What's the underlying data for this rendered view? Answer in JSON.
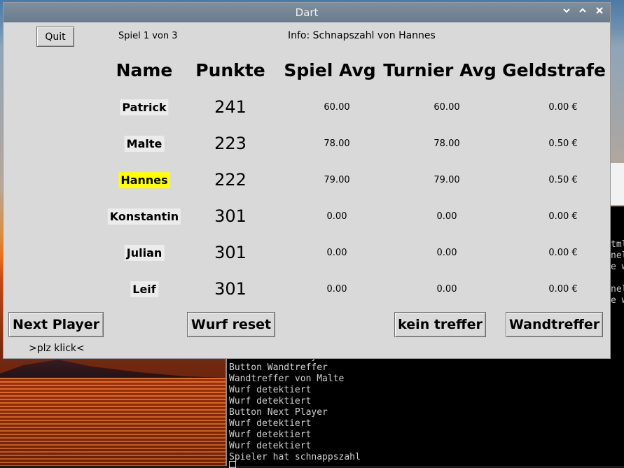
{
  "window": {
    "title": "Dart"
  },
  "header": {
    "quit_label": "Quit",
    "game_status": "Spiel 1 von 3",
    "info": "Info: Schnapszahl von Hannes"
  },
  "columns": [
    "Name",
    "Punkte",
    "Spiel Avg",
    "Turnier Avg",
    "Geldstrafe"
  ],
  "players": [
    {
      "name": "Patrick",
      "points": "241",
      "game_avg": "60.00",
      "tournament_avg": "60.00",
      "fine": "0.00 €",
      "active": false
    },
    {
      "name": "Malte",
      "points": "223",
      "game_avg": "78.00",
      "tournament_avg": "78.00",
      "fine": "0.50 €",
      "active": false
    },
    {
      "name": "Hannes",
      "points": "222",
      "game_avg": "79.00",
      "tournament_avg": "79.00",
      "fine": "0.50 €",
      "active": true
    },
    {
      "name": "Konstantin",
      "points": "301",
      "game_avg": "0.00",
      "tournament_avg": "0.00",
      "fine": "0.00 €",
      "active": false
    },
    {
      "name": "Julian",
      "points": "301",
      "game_avg": "0.00",
      "tournament_avg": "0.00",
      "fine": "0.00 €",
      "active": false
    },
    {
      "name": "Leif",
      "points": "301",
      "game_avg": "0.00",
      "tournament_avg": "0.00",
      "fine": "0.00 €",
      "active": false
    }
  ],
  "buttons": {
    "next_player": "Next Player",
    "reset_throw": "Wurf reset",
    "no_hit": "kein treffer",
    "wall_hit": "Wandtreffer"
  },
  "hint": ">plz klick<",
  "terminal": {
    "lines": [
      "Button Next Player",
      "Button Wandtreffer",
      "Wandtreffer von Malte",
      "Wurf detektiert",
      "Wurf detektiert",
      "Button Next Player",
      "Wurf detektiert",
      "Wurf detektiert",
      "Wurf detektiert",
      "Spieler hat schnappszahl"
    ],
    "right_fragments": [
      "tml",
      "nel",
      "e w",
      "nel",
      "e w"
    ]
  },
  "colors": {
    "active_player": "#ffff00",
    "window_bg": "#d9d9d9",
    "titlebar": "#6f8191"
  }
}
